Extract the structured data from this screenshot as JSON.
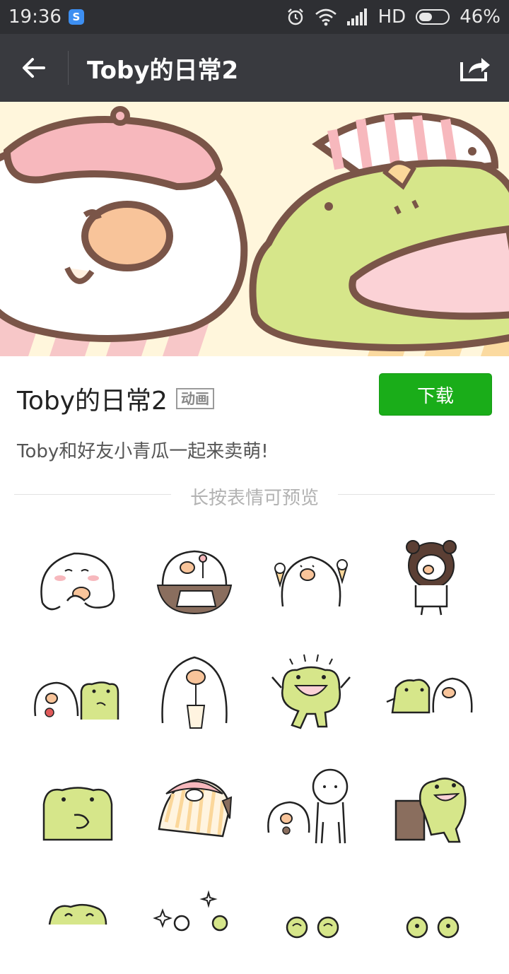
{
  "status_bar": {
    "time": "19:36",
    "network": "HD",
    "battery_percent": "46%",
    "battery_level": 0.46
  },
  "top_bar": {
    "title": "Toby的日常2"
  },
  "pack": {
    "name": "Toby的日常2",
    "tag": "动画",
    "download_label": "下载",
    "description": "Toby和好友小青瓜一起来卖萌!",
    "preview_hint": "长按表情可预览"
  },
  "stickers": [
    {
      "icon": "blob-blushing"
    },
    {
      "icon": "blob-at-table"
    },
    {
      "icon": "blob-ice-cream"
    },
    {
      "icon": "blob-bear-hood"
    },
    {
      "icon": "blob-and-frog"
    },
    {
      "icon": "blob-drinking"
    },
    {
      "icon": "frog-cheering"
    },
    {
      "icon": "frog-and-blob"
    },
    {
      "icon": "frog-peeking"
    },
    {
      "icon": "blob-in-blanket"
    },
    {
      "icon": "blob-and-friend"
    },
    {
      "icon": "frog-leaning"
    },
    {
      "icon": "frog-peek-bottom"
    },
    {
      "icon": "blob-sparkles"
    },
    {
      "icon": "frog-peek-bottom"
    },
    {
      "icon": "frog-peek-bottom"
    }
  ],
  "colors": {
    "status_bg": "#2e2f33",
    "top_bar_bg": "#393a3f",
    "download_green": "#1aad19",
    "frog_green": "#d6e68a",
    "outline_brown": "#7a5548",
    "beak_orange": "#f8c49a",
    "hat_pink": "#f7b8bd"
  }
}
